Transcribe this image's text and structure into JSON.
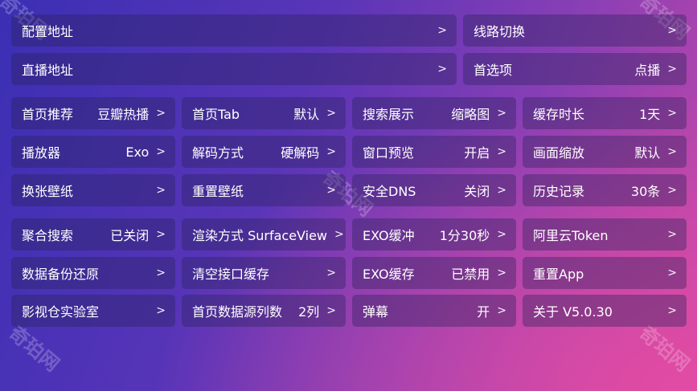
{
  "watermark": "奇珀网",
  "chevron": ">",
  "top_rows": [
    {
      "left": {
        "label": "配置地址",
        "value": ""
      },
      "right": {
        "label": "线路切换",
        "value": ""
      }
    },
    {
      "left": {
        "label": "直播地址",
        "value": ""
      },
      "right": {
        "label": "首选项",
        "value": "点播"
      }
    }
  ],
  "grid": [
    [
      {
        "label": "首页推荐",
        "value": "豆瓣热播"
      },
      {
        "label": "首页Tab",
        "value": "默认"
      },
      {
        "label": "搜索展示",
        "value": "缩略图"
      },
      {
        "label": "缓存时长",
        "value": "1天"
      }
    ],
    [
      {
        "label": "播放器",
        "value": "Exo"
      },
      {
        "label": "解码方式",
        "value": "硬解码"
      },
      {
        "label": "窗口预览",
        "value": "开启"
      },
      {
        "label": "画面缩放",
        "value": "默认"
      }
    ],
    [
      {
        "label": "换张壁纸",
        "value": ""
      },
      {
        "label": "重置壁纸",
        "value": ""
      },
      {
        "label": "安全DNS",
        "value": "关闭"
      },
      {
        "label": "历史记录",
        "value": "30条"
      }
    ],
    [
      {
        "label": "聚合搜索",
        "value": "已关闭"
      },
      {
        "label": "渲染方式 SurfaceView",
        "value": ""
      },
      {
        "label": "EXO缓冲",
        "value": "1分30秒"
      },
      {
        "label": "阿里云Token",
        "value": ""
      }
    ],
    [
      {
        "label": "数据备份还原",
        "value": ""
      },
      {
        "label": "清空接口缓存",
        "value": ""
      },
      {
        "label": "EXO缓存",
        "value": "已禁用"
      },
      {
        "label": "重置App",
        "value": ""
      }
    ],
    [
      {
        "label": "影视仓实验室",
        "value": ""
      },
      {
        "label": "首页数据源列数",
        "value": "2列"
      },
      {
        "label": "弹幕",
        "value": "开"
      },
      {
        "label": "关于  V5.0.30",
        "value": ""
      }
    ]
  ]
}
